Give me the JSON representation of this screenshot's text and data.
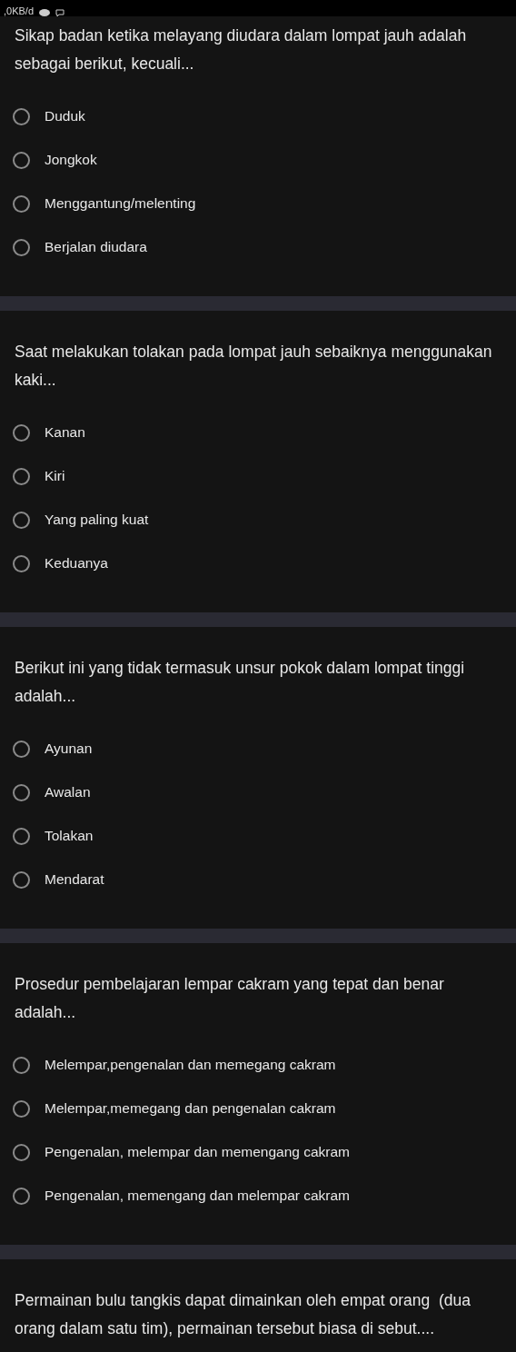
{
  "status_bar": {
    "text": ",0KB/d"
  },
  "questions": [
    {
      "text": "Sikap badan ketika melayang diudara dalam lompat jauh adalah sebagai berikut, kecuali...",
      "options": [
        {
          "label": "Duduk",
          "selected": false
        },
        {
          "label": "Jongkok",
          "selected": false
        },
        {
          "label": "Menggantung/melenting",
          "selected": false
        },
        {
          "label": "Berjalan diudara",
          "selected": false
        }
      ]
    },
    {
      "text": "Saat melakukan tolakan pada lompat jauh sebaiknya menggunakan kaki...",
      "options": [
        {
          "label": "Kanan",
          "selected": false
        },
        {
          "label": "Kiri",
          "selected": false
        },
        {
          "label": "Yang paling kuat",
          "selected": false
        },
        {
          "label": "Keduanya",
          "selected": false
        }
      ]
    },
    {
      "text": "Berikut ini yang tidak termasuk unsur pokok dalam lompat tinggi adalah...",
      "options": [
        {
          "label": "Ayunan",
          "selected": false
        },
        {
          "label": "Awalan",
          "selected": false
        },
        {
          "label": "Tolakan",
          "selected": false
        },
        {
          "label": "Mendarat",
          "selected": false
        }
      ]
    },
    {
      "text": "Prosedur pembelajaran lempar cakram yang tepat dan benar adalah...",
      "options": [
        {
          "label": "Melempar,pengenalan dan memegang cakram",
          "selected": false
        },
        {
          "label": "Melempar,memegang dan pengenalan cakram",
          "selected": false
        },
        {
          "label": "Pengenalan, melempar dan memengang cakram",
          "selected": false
        },
        {
          "label": "Pengenalan, memengang dan melempar cakram",
          "selected": false
        }
      ]
    },
    {
      "text": "Permainan bulu tangkis dapat dimainkan oleh empat orang  (dua orang dalam satu tim), permainan tersebut biasa di sebut...."
    }
  ]
}
